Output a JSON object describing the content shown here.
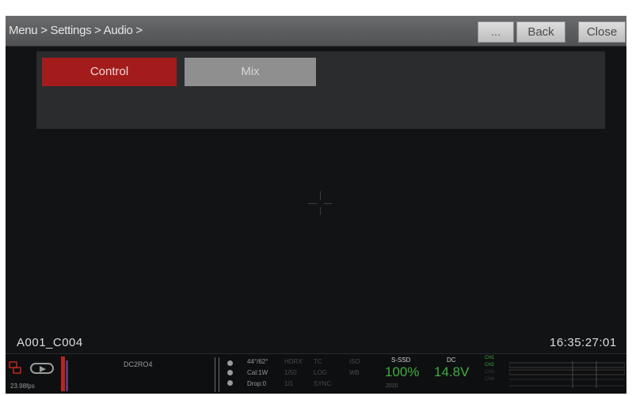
{
  "header": {
    "breadcrumb": "Menu > Settings > Audio >",
    "buttons": {
      "ellipsis": "...",
      "back": "Back",
      "close": "Close"
    }
  },
  "tabs": [
    {
      "label": "Control",
      "active": true
    },
    {
      "label": "Mix",
      "active": false
    }
  ],
  "viewport": {
    "clip_name": "A001_C004",
    "timecode": "16:35:27:01"
  },
  "status": {
    "framerate": "23.98fps",
    "media": "DC2RO4",
    "col1": [
      "44°/62°",
      "Cal:1W",
      "Drop:0"
    ],
    "col2": [
      "HDRX",
      "1/50",
      "1/1"
    ],
    "col3": [
      "TC",
      "LOG",
      "SYNC"
    ],
    "col4": [
      "ISO",
      "WB",
      ""
    ],
    "ssd": {
      "label": "S-SSD",
      "value": "100%",
      "sub": "2020"
    },
    "power": {
      "label": "DC",
      "value": "14.8V"
    },
    "channels": [
      "CH1",
      "CH2",
      "CH3",
      "CH4"
    ]
  },
  "colors": {
    "active_tab": "#a31c1c",
    "inactive_tab": "#8f8f8f",
    "status_green": "#3fae3f",
    "record_red": "#b8271f"
  }
}
